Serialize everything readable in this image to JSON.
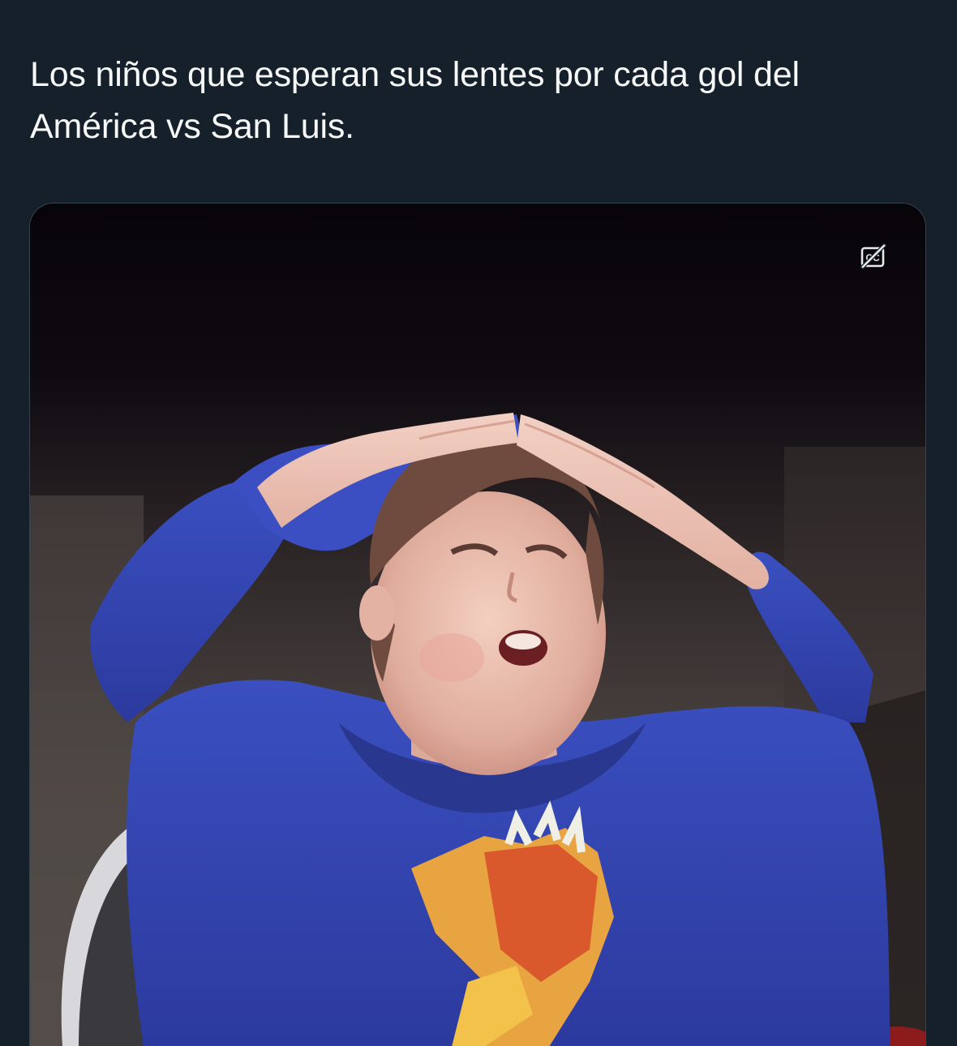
{
  "tweet": {
    "text": "Los niños que esperan sus lentes por cada gol del\nAmérica vs San Luis."
  },
  "media": {
    "type": "video",
    "captions_button": {
      "icon": "captions-off-icon",
      "label": "CC"
    }
  },
  "theme": {
    "background": "#15202b",
    "text": "#f7f9f9",
    "border": "#38444d"
  }
}
